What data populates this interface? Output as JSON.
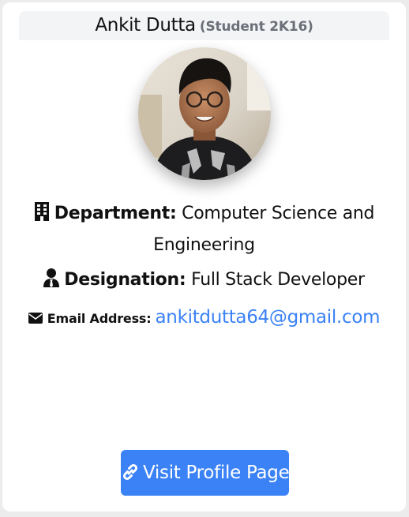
{
  "profile": {
    "name": "Ankit Dutta",
    "subtitle": "(Student 2K16)",
    "avatar_alt": "Profile photo of Ankit Dutta"
  },
  "department": {
    "icon": "building-icon",
    "label": "Department:",
    "value": "Computer Science and Engineering"
  },
  "designation": {
    "icon": "user-tie-icon",
    "label": "Designation:",
    "value": "Full Stack Developer"
  },
  "email": {
    "icon": "envelope-icon",
    "label": "Email Address:",
    "value": "ankitdutta64@gmail.com"
  },
  "actions": {
    "visit_icon": "link-icon",
    "visit_label": "Visit Profile Page"
  },
  "colors": {
    "accent": "#3b82f6",
    "header_bg": "#f3f4f6",
    "subtitle": "#6b6f78"
  }
}
